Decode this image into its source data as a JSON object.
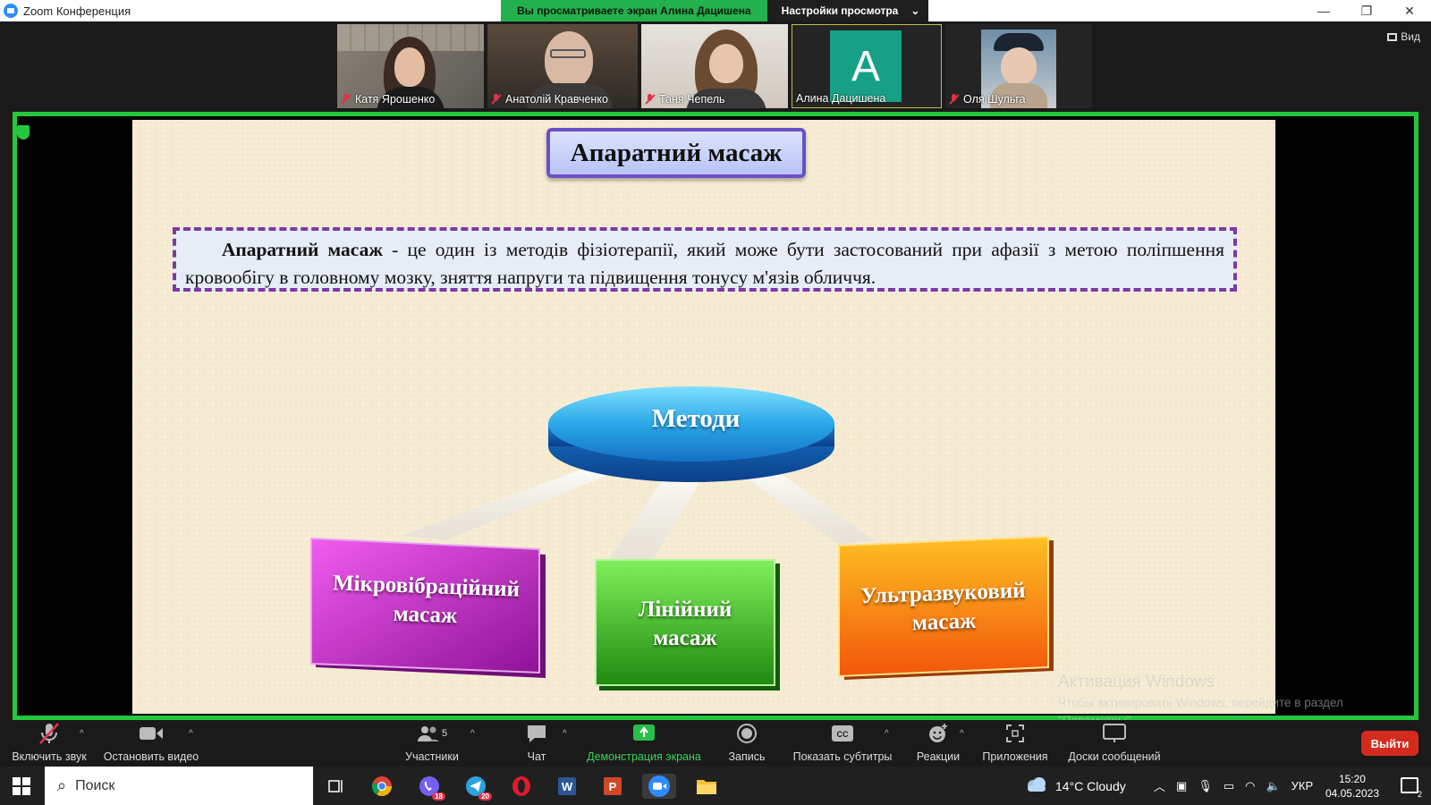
{
  "window": {
    "title": "Zoom Конференция",
    "share_banner": "Вы просматриваете экран Алина Дацишена",
    "view_settings": "Настройки просмотра"
  },
  "participants": [
    {
      "name": "Катя Ярошенко",
      "muted": true
    },
    {
      "name": "Анатолій Кравченко",
      "muted": true
    },
    {
      "name": "Таня Чепель",
      "muted": true
    },
    {
      "name": "Алина Дацишена",
      "muted": false,
      "avatar_letter": "A"
    },
    {
      "name": "Оля Шульга",
      "muted": true
    }
  ],
  "view_button": "Вид",
  "slide": {
    "title": "Апаратний масаж",
    "definition_term": "Апаратний масаж",
    "definition_text": " - це один із методів фізіотерапії, який може бути застосований при афазії з метою поліпшення кровообігу в головному мозку, зняття напруги та підвищення тонусу м'язів обличчя.",
    "center_label": "Методи",
    "methods": [
      {
        "label_line1": "Мікровібраційний",
        "label_line2": "масаж",
        "color": "#c21fc5"
      },
      {
        "label_line1": "Лінійний",
        "label_line2": "масаж",
        "color": "#2bb51c"
      },
      {
        "label_line1": "Ультразвуковий",
        "label_line2": "масаж",
        "color": "#f07a10"
      }
    ]
  },
  "watermark": {
    "title": "Активация Windows",
    "line1": "Чтобы активировать Windows, перейдите в раздел",
    "line2": "\"Параметры\"."
  },
  "toolbar": {
    "unmute": "Включить звук",
    "stop_video": "Остановить видео",
    "participants": "Участники",
    "participants_count": "5",
    "chat": "Чат",
    "share": "Демонстрация экрана",
    "record": "Запись",
    "captions": "Показать субтитры",
    "reactions": "Реакции",
    "apps": "Приложения",
    "whiteboards": "Доски сообщений",
    "leave": "Выйти"
  },
  "taskbar": {
    "search_placeholder": "Поиск",
    "weather": "14°C  Cloudy",
    "language": "УКР",
    "time": "15:20",
    "date": "04.05.2023",
    "viber_badge": "18",
    "telegram_badge": "20",
    "notif_count": "2"
  }
}
